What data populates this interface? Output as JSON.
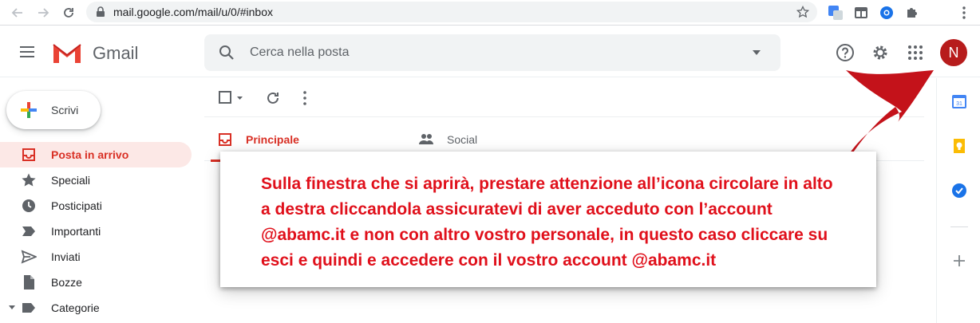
{
  "browser": {
    "url": "mail.google.com/mail/u/0/#inbox"
  },
  "header": {
    "logo_text": "Gmail",
    "search_placeholder": "Cerca nella posta",
    "avatar_letter": "N"
  },
  "sidebar": {
    "compose_label": "Scrivi",
    "items": [
      {
        "label": "Posta in arrivo",
        "icon": "inbox-icon"
      },
      {
        "label": "Speciali",
        "icon": "star-icon"
      },
      {
        "label": "Posticipati",
        "icon": "clock-icon"
      },
      {
        "label": "Importanti",
        "icon": "label-important-icon"
      },
      {
        "label": "Inviati",
        "icon": "send-icon"
      },
      {
        "label": "Bozze",
        "icon": "draft-icon"
      },
      {
        "label": "Categorie",
        "icon": "label-icon"
      }
    ]
  },
  "tabs": [
    {
      "label": "Principale",
      "icon": "inbox-icon"
    },
    {
      "label": "Social",
      "icon": "people-icon"
    }
  ],
  "overlay": {
    "text": "Sulla finestra che si aprirà, prestare attenzione all’icona circolare in alto a destra cliccandola assicuratevi di aver acceduto con l’account @abamc.it e non con altro vostro personale, in questo caso cliccare su esci e quindi e accedere con il vostro account @abamc.it"
  },
  "colors": {
    "accent": "#d93025",
    "overlay_text": "#e0101b",
    "avatar_bg": "#b71c1c"
  }
}
